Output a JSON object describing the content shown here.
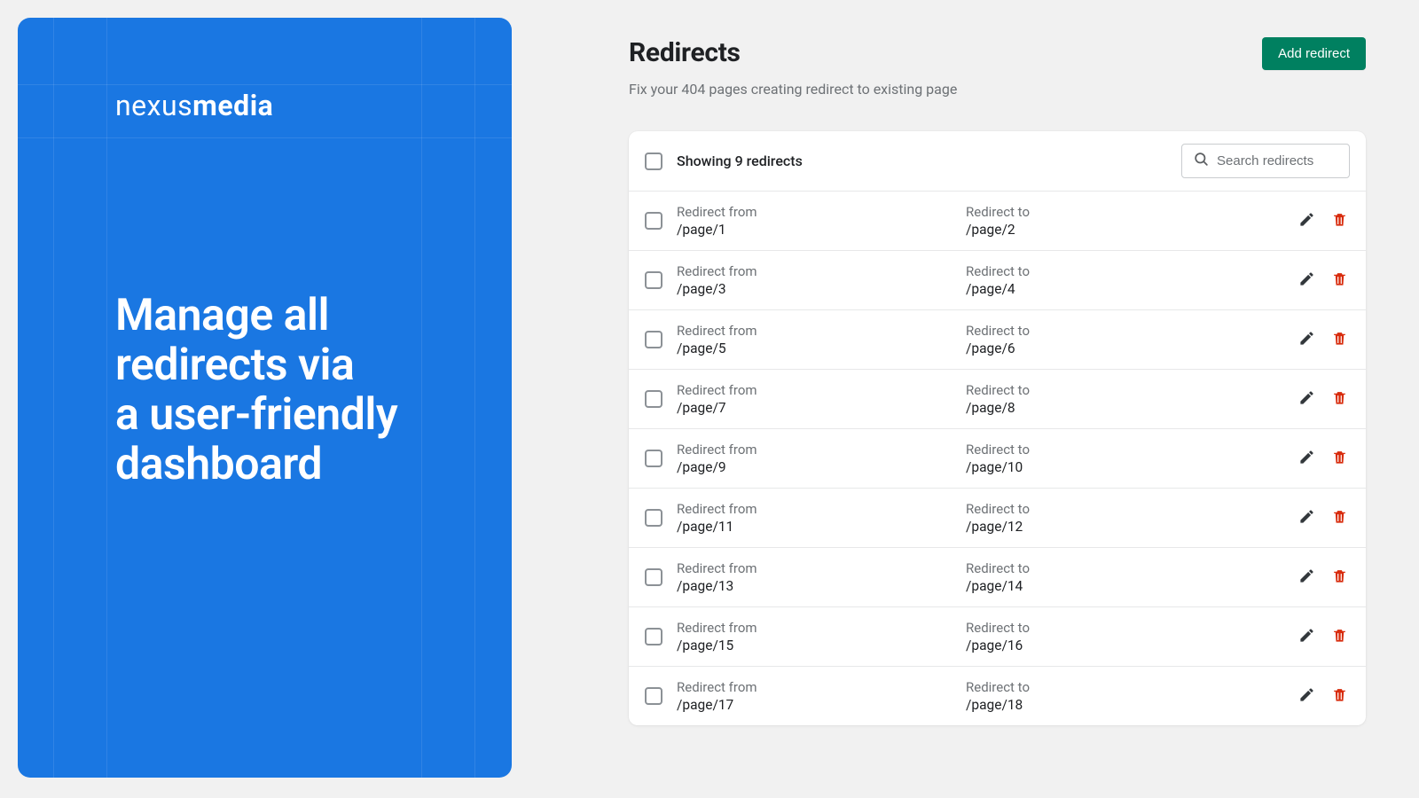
{
  "brand": {
    "part1": "nexus",
    "part2": "media"
  },
  "headline": "Manage all redirects via a user-friendly dashboard",
  "page_title": "Redirects",
  "subtitle": "Fix your 404 pages creating redirect to existing page",
  "add_button": "Add redirect",
  "showing_text": "Showing 9 redirects",
  "search_placeholder": "Search redirects",
  "labels": {
    "from": "Redirect from",
    "to": "Redirect to"
  },
  "colors": {
    "primary_blue": "#1a77e2",
    "action_green": "#008060",
    "delete_red": "#d82c0d",
    "edit_dark": "#33383c"
  },
  "redirects": [
    {
      "from": "/page/1",
      "to": "/page/2"
    },
    {
      "from": "/page/3",
      "to": "/page/4"
    },
    {
      "from": "/page/5",
      "to": "/page/6"
    },
    {
      "from": "/page/7",
      "to": "/page/8"
    },
    {
      "from": "/page/9",
      "to": "/page/10"
    },
    {
      "from": "/page/11",
      "to": "/page/12"
    },
    {
      "from": "/page/13",
      "to": "/page/14"
    },
    {
      "from": "/page/15",
      "to": "/page/16"
    },
    {
      "from": "/page/17",
      "to": "/page/18"
    }
  ]
}
